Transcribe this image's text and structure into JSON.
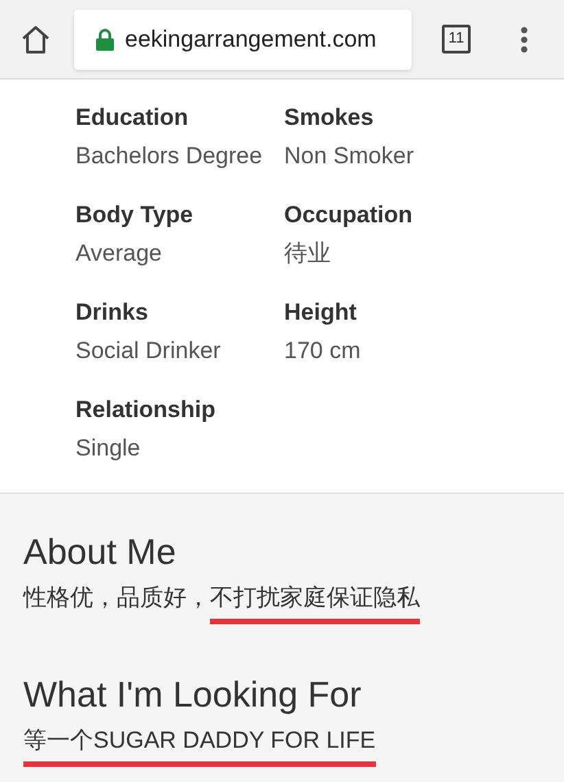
{
  "browser": {
    "url": "eekingarrangement.com",
    "secure": true,
    "tab_count": "11"
  },
  "details": [
    {
      "label": "Education",
      "value": "Bachelors Degree"
    },
    {
      "label": "Smokes",
      "value": "Non Smoker"
    },
    {
      "label": "Body Type",
      "value": "Average"
    },
    {
      "label": "Occupation",
      "value": "待业"
    },
    {
      "label": "Drinks",
      "value": "Social Drinker"
    },
    {
      "label": "Height",
      "value": "170 cm"
    },
    {
      "label": "Relationship",
      "value": "Single"
    }
  ],
  "sections": [
    {
      "title": "About Me",
      "segments": [
        {
          "text": "性格优，品质好，",
          "underlined": false
        },
        {
          "text": "不打扰家庭保证隐私",
          "underlined": true
        }
      ]
    },
    {
      "title": "What I'm Looking For",
      "segments": [
        {
          "text": "等一个SUGAR DADDY FOR LIFE",
          "underlined": true
        }
      ]
    }
  ]
}
